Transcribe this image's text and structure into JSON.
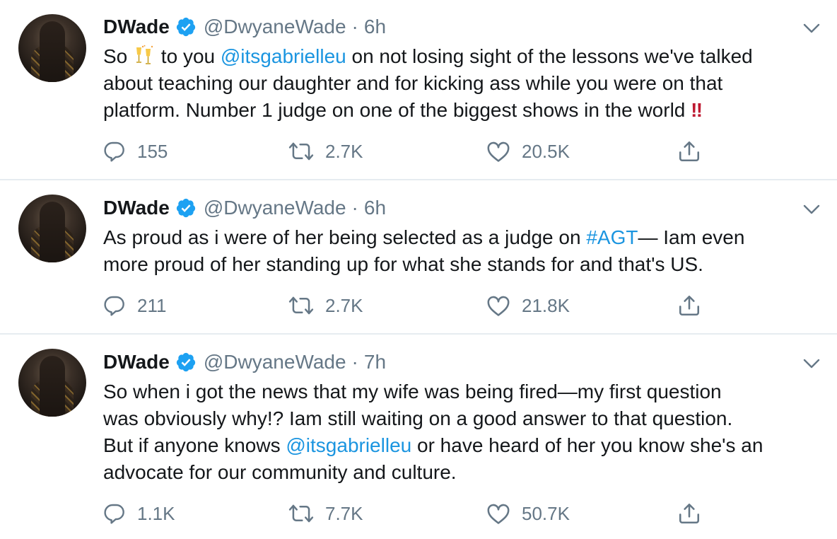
{
  "tweets": [
    {
      "name": "DWade",
      "handle": "@DwyaneWade",
      "dot": "·",
      "time": "6h",
      "text_parts": [
        "So ",
        " to you ",
        "@itsgabrielleu",
        " on not losing sight of the lessons we've talked",
        "about teaching our daughter and for kicking ass while you were on that",
        "platform. Number 1 judge on one of the biggest shows in the world",
        "‼"
      ],
      "replies": "155",
      "retweets": "2.7K",
      "likes": "20.5K"
    },
    {
      "name": "DWade",
      "handle": "@DwyaneWade",
      "dot": "·",
      "time": "6h",
      "text_parts": [
        "As proud as i were of her being selected as a judge on ",
        "#AGT",
        "— Iam even",
        "more proud of her standing up for what she stands for and that's US."
      ],
      "replies": "211",
      "retweets": "2.7K",
      "likes": "21.8K"
    },
    {
      "name": "DWade",
      "handle": "@DwyaneWade",
      "dot": "·",
      "time": "7h",
      "text_parts": [
        "So when i got the news that my wife was being fired—my first question",
        "was obviously why!? Iam still waiting on a good answer to that question.",
        "But if anyone knows ",
        "@itsgabrielleu",
        " or have heard of her you know she's an",
        "advocate for our community and culture."
      ],
      "replies": "1.1K",
      "retweets": "7.7K",
      "likes": "50.7K"
    }
  ],
  "icons": {
    "verified": "verified-badge-icon",
    "reply": "reply-icon",
    "retweet": "retweet-icon",
    "like": "heart-icon",
    "share": "share-icon",
    "more": "chevron-down-icon"
  },
  "colors": {
    "link": "#1b95e0",
    "muted": "#657786",
    "divider": "#e6ecf0",
    "bang": "#be1931"
  }
}
